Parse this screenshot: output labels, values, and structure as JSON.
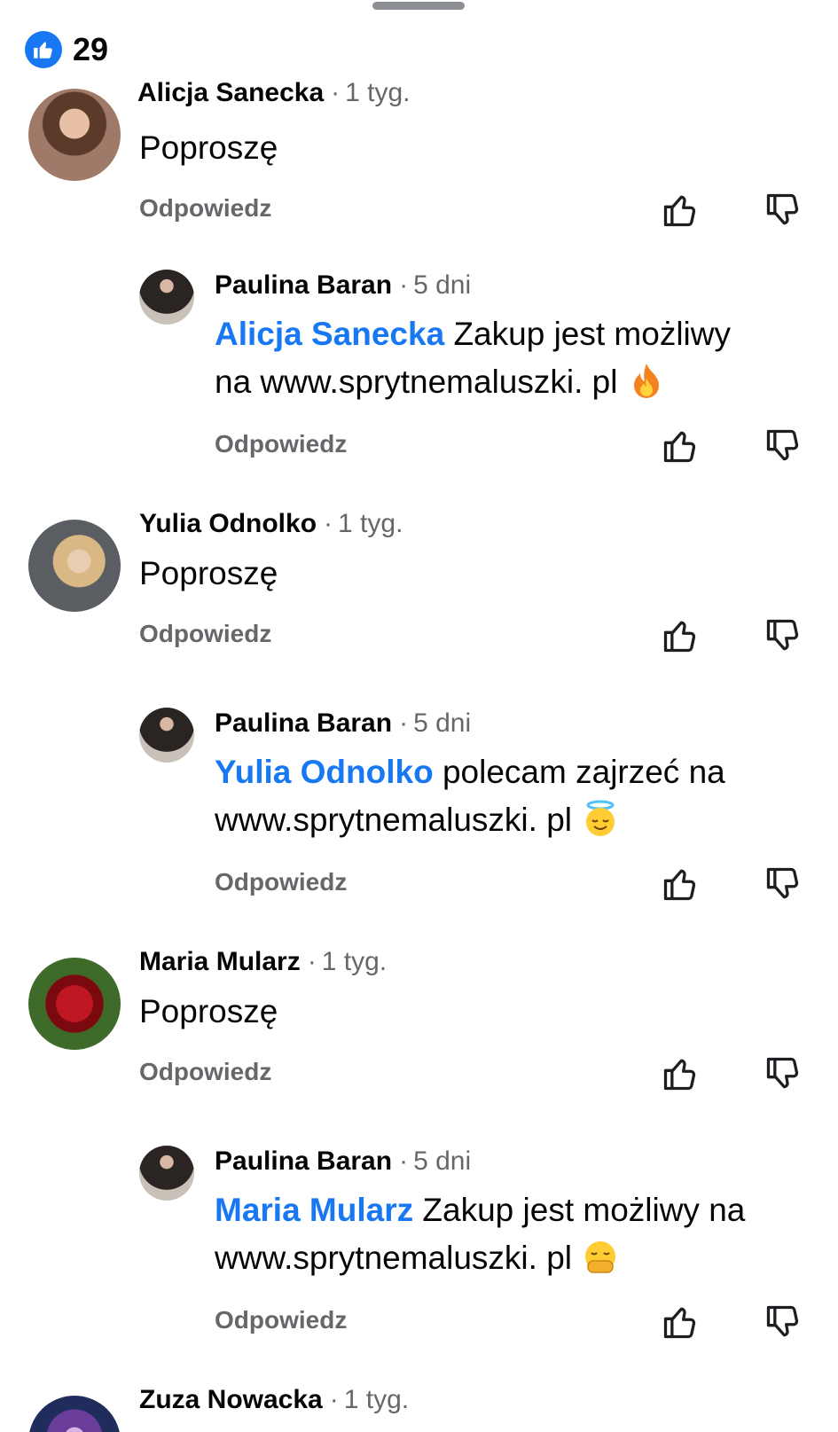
{
  "header": {
    "like_count": "29",
    "like_icon": "thumbs-up-icon"
  },
  "comments": [
    {
      "author": "Alicja Sanecka",
      "separator": "·",
      "time": "1 tyg.",
      "text": "Poproszę",
      "reply_label": "Odpowiedz",
      "replies": [
        {
          "author": "Paulina Baran",
          "separator": "·",
          "time": "5 dni",
          "mention": "Alicja Sanecka",
          "text_line1": " Zakup jest możliwy",
          "text_line2": "na www.sprytnemaluszki. pl",
          "emoji": "fire-emoji",
          "reply_label": "Odpowiedz"
        }
      ]
    },
    {
      "author": "Yulia Odnolko",
      "separator": "·",
      "time": "1 tyg.",
      "text": "Poproszę",
      "reply_label": "Odpowiedz",
      "replies": [
        {
          "author": "Paulina Baran",
          "separator": "·",
          "time": "5 dni",
          "mention": "Yulia Odnolko",
          "text_line1": " polecam zajrzeć na",
          "text_line2": "www.sprytnemaluszki. pl",
          "emoji": "smiling-face-with-halo-emoji",
          "reply_label": "Odpowiedz"
        }
      ]
    },
    {
      "author": "Maria Mularz",
      "separator": "·",
      "time": "1 tyg.",
      "text": "Poproszę",
      "reply_label": "Odpowiedz",
      "replies": [
        {
          "author": "Paulina Baran",
          "separator": "·",
          "time": "5 dni",
          "mention": "Maria Mularz",
          "text_line1": " Zakup jest możliwy na",
          "text_line2": "www.sprytnemaluszki. pl",
          "emoji": "face-with-hand-over-mouth-emoji",
          "reply_label": "Odpowiedz"
        }
      ]
    },
    {
      "author": "Zuza Nowacka",
      "separator": "·",
      "time": "1 tyg."
    }
  ]
}
